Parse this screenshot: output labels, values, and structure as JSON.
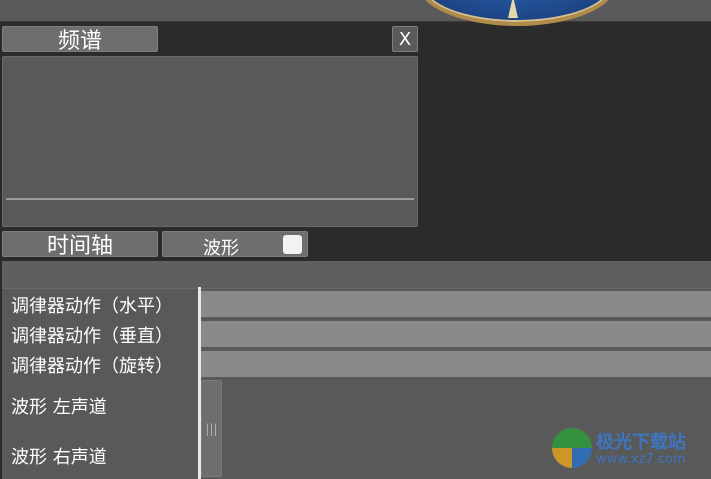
{
  "spectrum": {
    "title": "频谱",
    "close_label": "X"
  },
  "timeline": {
    "title": "时间轴",
    "waveform_toggle": {
      "label": "波形",
      "checked": false
    },
    "tracks": [
      {
        "label": "调律器动作（水平）"
      },
      {
        "label": "调律器动作（垂直）"
      },
      {
        "label": "调律器动作（旋转）"
      },
      {
        "label": "波形 左声道"
      },
      {
        "label": "波形 右声道"
      }
    ],
    "scroll_handle_glyph": "|||"
  },
  "watermark": {
    "title": "极光下载站",
    "url": "www.xz7.com"
  },
  "colors": {
    "background": "#2b2b2b",
    "panel": "#595959",
    "button": "#6e6e6e",
    "track_bar": "#8a8a8a"
  }
}
